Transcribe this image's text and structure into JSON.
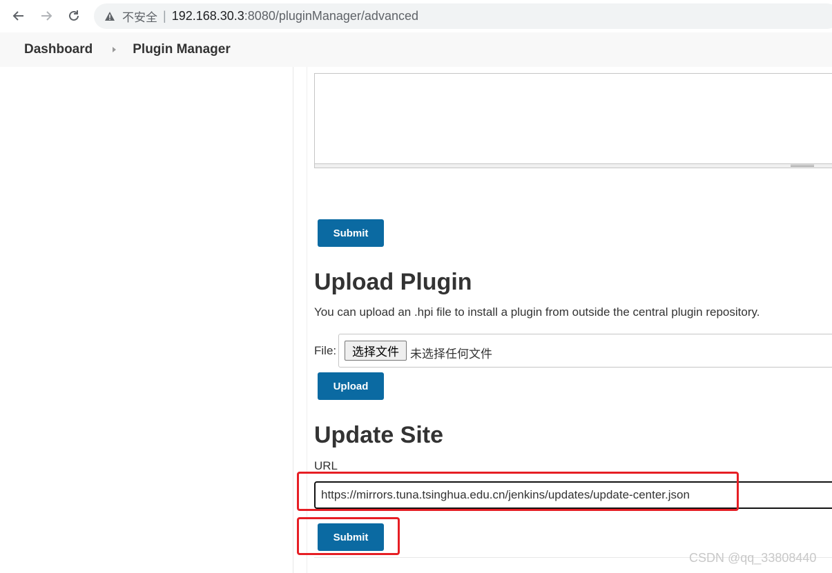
{
  "browser": {
    "insecure_label": "不安全",
    "separator": "|",
    "url_host": "192.168.30.3",
    "url_rest": ":8080/pluginManager/advanced"
  },
  "breadcrumb": {
    "items": [
      {
        "label": "Dashboard"
      },
      {
        "label": "Plugin Manager"
      }
    ]
  },
  "proxy_section": {
    "submit_label": "Submit"
  },
  "upload_section": {
    "title": "Upload Plugin",
    "description": "You can upload an .hpi file to install a plugin from outside the central plugin repository.",
    "file_label": "File:",
    "choose_button": "选择文件",
    "no_file_text": "未选择任何文件",
    "upload_label": "Upload"
  },
  "update_site_section": {
    "title": "Update Site",
    "url_label": "URL",
    "url_value": "https://mirrors.tuna.tsinghua.edu.cn/jenkins/updates/update-center.json",
    "submit_label": "Submit"
  },
  "watermark": "CSDN @qq_33808440",
  "colors": {
    "primary_button": "#0b6aa2",
    "highlight": "#e61e24"
  }
}
